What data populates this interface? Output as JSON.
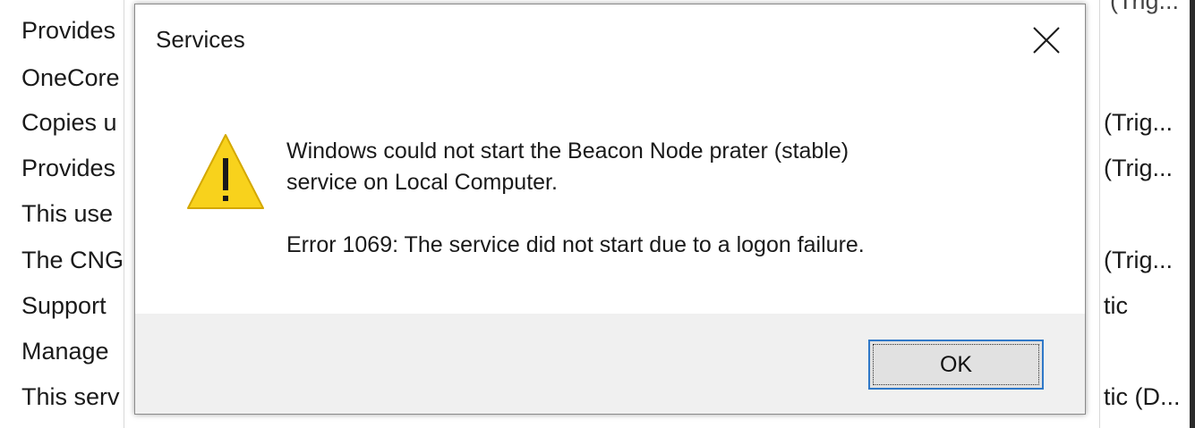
{
  "background": {
    "left_column": [
      "Provides",
      "OneCore",
      "Copies u",
      "Provides",
      "This use",
      "The CNG",
      "Support",
      "Manage",
      "This serv"
    ],
    "right_column": [
      {
        "row": 2,
        "text": "(Trig..."
      },
      {
        "row": 3,
        "text": "(Trig..."
      },
      {
        "row": 5,
        "text": "(Trig..."
      },
      {
        "row": 6,
        "text": "tic"
      },
      {
        "row": 8,
        "text": "tic (D..."
      }
    ],
    "top_right_fragment": "(Trig..."
  },
  "dialog": {
    "title": "Services",
    "message_line1": "Windows could not start the Beacon Node prater (stable)",
    "message_line2": "service on Local Computer.",
    "error_text": "Error 1069: The service did not start due to a logon failure.",
    "ok_label": "OK",
    "icon": "warning-icon",
    "close_icon": "close-icon"
  },
  "colors": {
    "warning_fill": "#f8d21c",
    "warning_stroke": "#d4a800",
    "ok_border": "#2f78c8",
    "footer_bg": "#f0f0f0"
  }
}
